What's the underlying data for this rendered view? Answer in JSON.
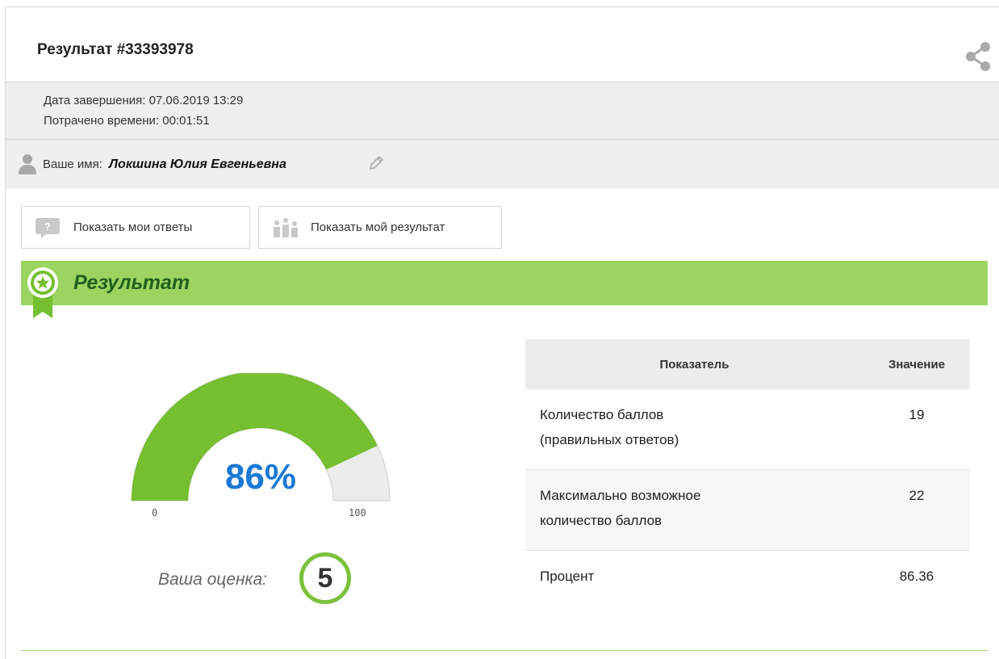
{
  "header": {
    "title": "Результат #33393978",
    "share_icon": "share-icon"
  },
  "info": {
    "completion_date": "Дата завершения: 07.06.2019 13:29",
    "time_spent": "Потрачено времени: 00:01:51"
  },
  "user": {
    "label": "Ваше имя:",
    "name": "Локшина Юлия Евгеньевна"
  },
  "buttons": {
    "show_answers": "Показать мои ответы",
    "show_result": "Показать мой результат"
  },
  "result": {
    "title": "Результат",
    "gauge": {
      "value": 86,
      "value_label": "86%",
      "min": "0",
      "max": "100"
    },
    "grade_label": "Ваша оценка:",
    "grade": "5"
  },
  "table": {
    "headers": [
      "Показатель",
      "Значение"
    ],
    "rows": [
      {
        "label": "Количество баллов (правильных ответов)",
        "value": "19"
      },
      {
        "label": "Максимально возможное количество баллов",
        "value": "22"
      },
      {
        "label": "Процент",
        "value": "86.36"
      }
    ]
  },
  "colors": {
    "accent_green": "#76bf30",
    "banner_green": "#9bd460",
    "banner_text": "#236020",
    "gauge_value": "#1a79d6"
  }
}
